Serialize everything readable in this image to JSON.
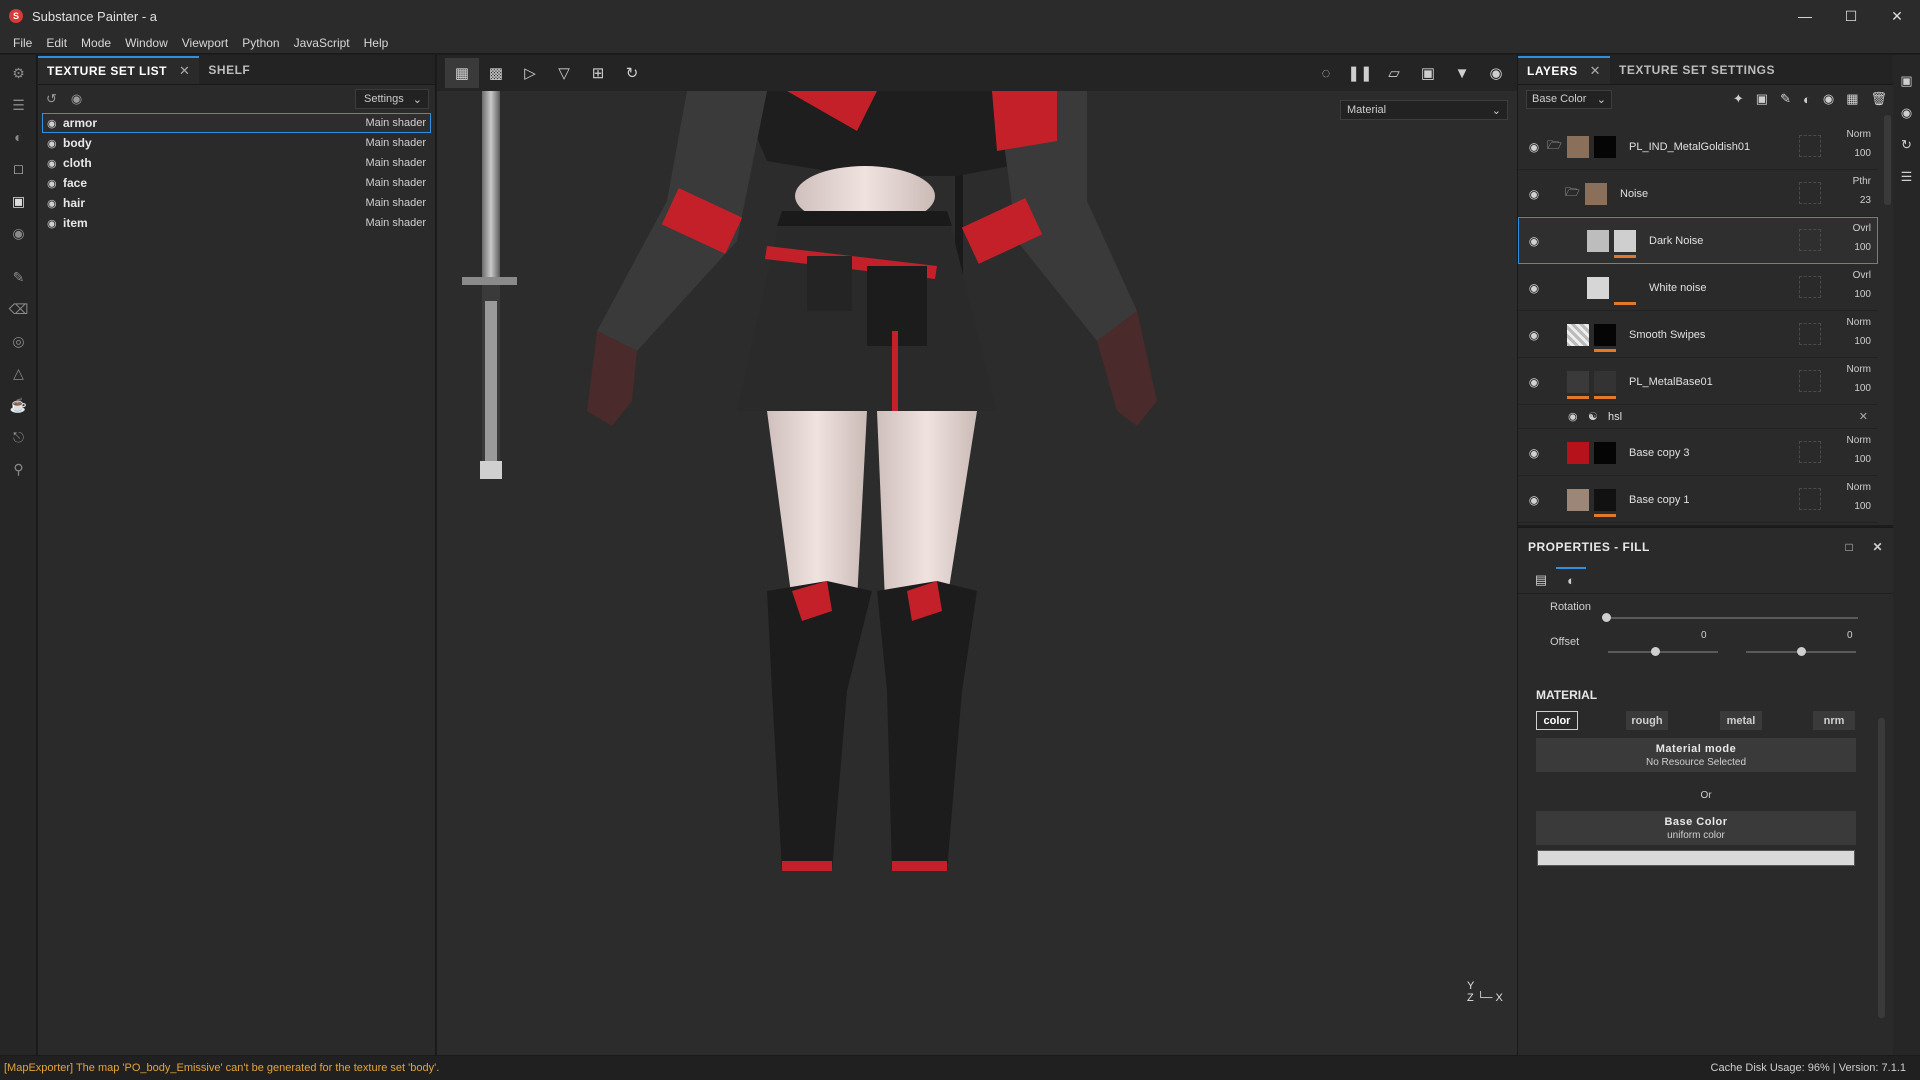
{
  "window": {
    "title": "Substance Painter - a",
    "controls": [
      "minimize",
      "maximize",
      "close"
    ]
  },
  "menu": [
    "File",
    "Edit",
    "Mode",
    "Window",
    "Viewport",
    "Python",
    "JavaScript",
    "Help"
  ],
  "texture_panel": {
    "tabs": [
      "TEXTURE SET LIST",
      "SHELF"
    ],
    "settings_label": "Settings",
    "sets": [
      {
        "name": "armor",
        "shader": "Main shader"
      },
      {
        "name": "body",
        "shader": "Main shader"
      },
      {
        "name": "cloth",
        "shader": "Main shader"
      },
      {
        "name": "face",
        "shader": "Main shader"
      },
      {
        "name": "hair",
        "shader": "Main shader"
      },
      {
        "name": "item",
        "shader": "Main shader"
      }
    ],
    "selected_index": 0
  },
  "viewport": {
    "mode": "Material",
    "axis_y": "Y",
    "axis_x": "X",
    "axis_z": "Z"
  },
  "layers": {
    "tabs": [
      "LAYERS",
      "TEXTURE SET SETTINGS"
    ],
    "channel": "Base Color",
    "items": [
      {
        "name": "PL_IND_MetalGoldish01",
        "blend": "Norm",
        "opacity": "100"
      },
      {
        "name": "Noise",
        "blend": "Pthr",
        "opacity": "23"
      },
      {
        "name": "Dark Noise",
        "blend": "Ovrl",
        "opacity": "100"
      },
      {
        "name": "White noise",
        "blend": "Ovrl",
        "opacity": "100"
      },
      {
        "name": "Smooth Swipes",
        "blend": "Norm",
        "opacity": "100"
      },
      {
        "name": "PL_MetalBase01",
        "blend": "Norm",
        "opacity": "100"
      },
      {
        "name": "Base copy 3",
        "blend": "Norm",
        "opacity": "100"
      },
      {
        "name": "Base copy 1",
        "blend": "Norm",
        "opacity": "100"
      }
    ],
    "effect_name": "hsl"
  },
  "properties": {
    "title": "PROPERTIES - FILL",
    "rotation_label": "Rotation",
    "offset_label": "Offset",
    "offset_x": "0",
    "offset_y": "0",
    "material_title": "MATERIAL",
    "channels": [
      "color",
      "rough",
      "metal",
      "nrm"
    ],
    "material_mode_title": "Material mode",
    "material_mode_value": "No Resource Selected",
    "or_label": "Or",
    "base_color_title": "Base Color",
    "base_color_value": "uniform color",
    "base_color_hex": "#d9d9d9"
  },
  "status": {
    "message": "[MapExporter] The map 'PO_body_Emissive' can't be generated for the texture set 'body'.",
    "right": "Cache Disk Usage:   96%  |  Version: 7.1.1"
  },
  "colors": {
    "accent": "#2f8fe0",
    "warning": "#e2a53a",
    "outfit_red": "#c4202a"
  }
}
